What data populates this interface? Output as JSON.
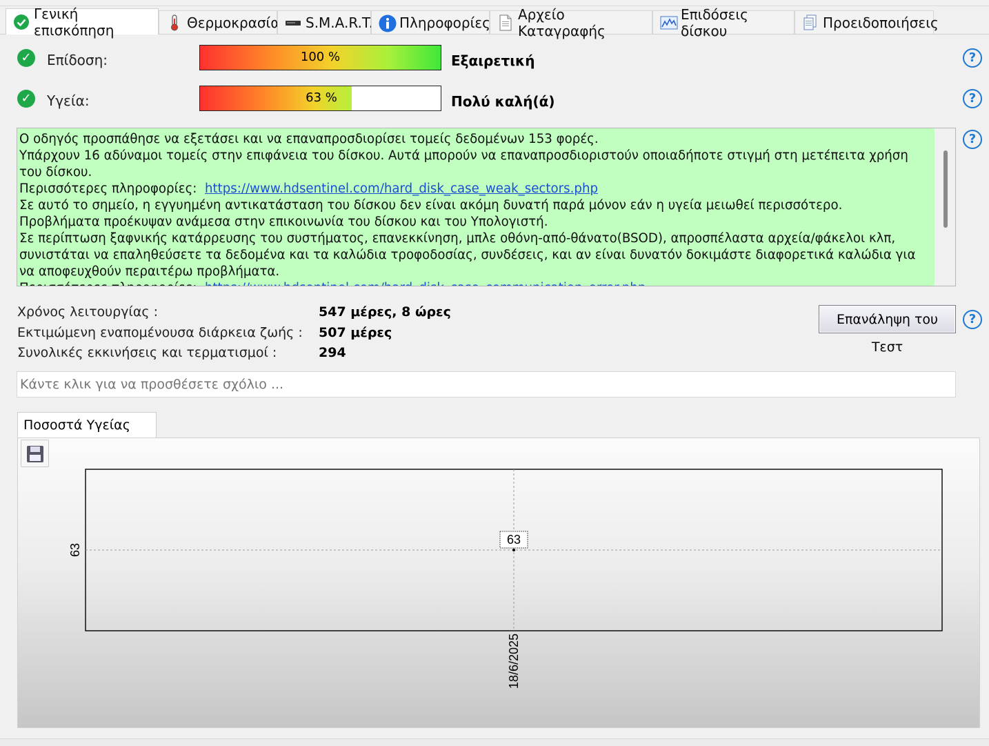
{
  "tabs": [
    {
      "label": "Γενική επισκόπηση",
      "icon": "check-circle-icon",
      "active": true
    },
    {
      "label": "Θερμοκρασία",
      "icon": "thermometer-icon",
      "active": false
    },
    {
      "label": "S.M.A.R.T.",
      "icon": "drive-icon",
      "active": false
    },
    {
      "label": "Πληροφορίες",
      "icon": "info-icon",
      "active": false
    },
    {
      "label": "Αρχείο Καταγραφής",
      "icon": "document-icon",
      "active": false
    },
    {
      "label": "Επιδόσεις δίσκου",
      "icon": "performance-chart-icon",
      "active": false
    },
    {
      "label": "Προειδοποιήσεις",
      "icon": "documents-icon",
      "active": false
    }
  ],
  "status": {
    "performance": {
      "label": "Επίδοση:",
      "percent": 100,
      "percent_text": "100 %",
      "verdict": "Εξαιρετική"
    },
    "health": {
      "label": "Υγεία:",
      "percent": 63,
      "percent_text": "63 %",
      "verdict": "Πολύ καλή(ά)"
    }
  },
  "message": {
    "line1": "Ο οδηγός προσπάθησε να εξετάσει και να επαναπροσδιορίσει τομείς δεδομένων 153 φορές.",
    "line2": "Υπάρχουν 16 αδύναμοι τομείς στην επιφάνεια του δίσκου. Αυτά μπορούν να επαναπροσδιοριστούν οποιαδήποτε στιγμή στη μετέπειτα χρήση του δίσκου.",
    "more_label": "Περισσότερες πληροφορίες:",
    "link1": "https://www.hdsentinel.com/hard_disk_case_weak_sectors.php",
    "line3": "Σε αυτό το σημείο, η εγγυημένη αντικατάσταση του δίσκου δεν είναι ακόμη δυνατή παρά μόνον εάν η υγεία μειωθεί περισσότερο.",
    "line4": "Προβλήματα προέκυψαν ανάμεσα στην επικοινωνία του δίσκου και του Υπολογιστή.",
    "line5": "Σε περίπτωση ξαφνικής κατάρρευσης του συστήματος, επανεκκίνηση, μπλε οθόνη-από-θάνατο(BSOD), απροσπέλαστα αρχεία/φάκελοι κλπ, συνιστάται να επαληθεύσετε τα δεδομένα και τα καλώδια τροφοδοσίας, συνδέσεις, και αν είναι δυνατόν δοκιμάστε διαφορετικά καλώδια για να αποφευχθούν περαιτέρω προβλήματα.",
    "more_label2": "Περισσότερες πληροφορίες:",
    "link2": "https://www.hdsentinel.com/hard_disk_case_communication_error.php"
  },
  "info": {
    "uptime_label": "Χρόνος λειτουργίας :",
    "uptime_value": "547 μέρες, 8 ώρες",
    "lifetime_label": "Εκτιμώμενη εναπομένουσα διάρκεια ζωής :",
    "lifetime_value": "507 μέρες",
    "starts_label": "Συνολικές εκκινήσεις και τερματισμοί :",
    "starts_value": "294"
  },
  "retest_button": "Επανάληψη του Τεστ",
  "comment_placeholder": "Κάντε κλικ για να προσθέσετε σχόλιο ...",
  "chart_tab": "Ποσοστά Υγείας (%)",
  "chart_data": {
    "type": "line",
    "title": "Ποσοστά Υγείας (%)",
    "x": [
      "18/6/2025"
    ],
    "series": [
      {
        "values": [
          63
        ]
      }
    ],
    "ytick_labels": [
      "63"
    ],
    "xtick_labels": [
      "18/6/2025"
    ],
    "data_labels": [
      "63"
    ],
    "grid": true
  },
  "colors": {
    "message_bg": "#c1ffc1",
    "ok_green": "#1fa84a",
    "help_blue": "#1f78d1",
    "link_blue": "#1a4fd6"
  }
}
